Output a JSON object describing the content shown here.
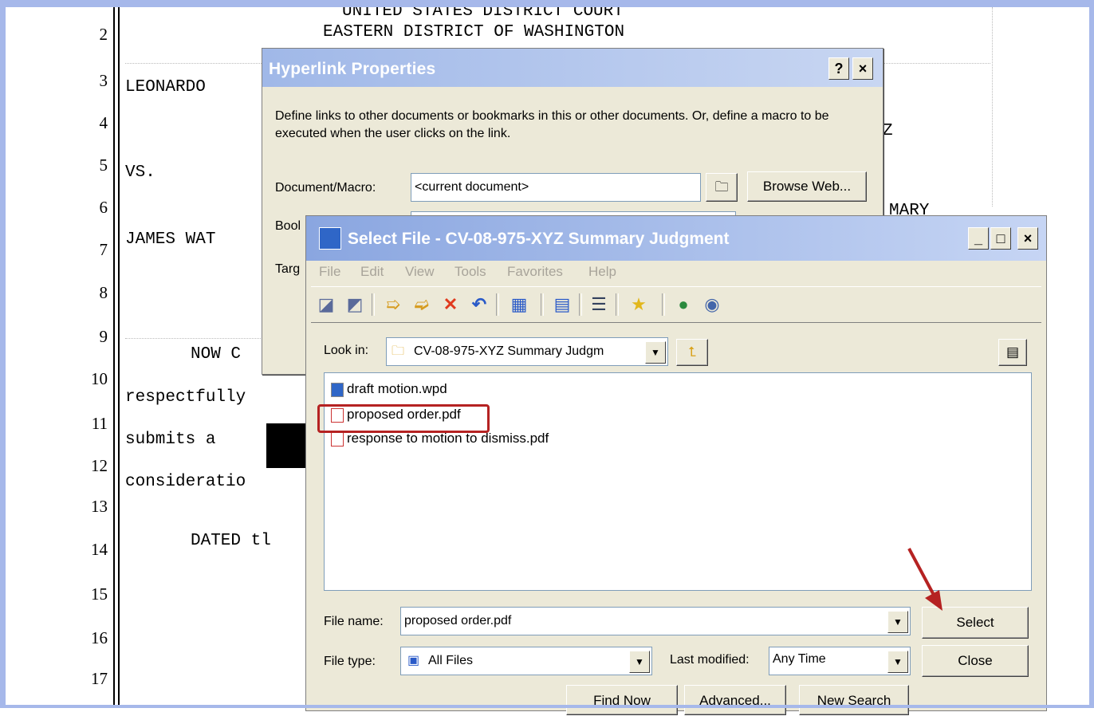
{
  "document": {
    "line_numbers": [
      "2",
      "3",
      "4",
      "5",
      "6",
      "7",
      "8",
      "9",
      "10",
      "11",
      "12",
      "13",
      "14",
      "15",
      "16",
      "17"
    ],
    "court_line1": "UNITED STATES DISTRICT COURT",
    "court_line2": "EASTERN DISTRICT OF WASHINGTON",
    "plaintiff": "LEONARDO",
    "vs": "VS.",
    "defendant": "JAMES WAT",
    "para1": "NOW C",
    "line_respectfully": "respectfully",
    "line_submits": "submits a",
    "line_consideration": "consideratio",
    "dated": "DATED tl",
    "right_fragment_1": "Z",
    "right_fragment_2": "MARY"
  },
  "hyperlink_dialog": {
    "title": "Hyperlink Properties",
    "help_button": "?",
    "close_button": "×",
    "description": "Define links to other documents or bookmarks in this or other documents. Or, define a macro to be executed when the user clicks on the link.",
    "document_macro_label": "Document/Macro:",
    "document_macro_value": "<current document>",
    "browse_web_label": "Browse Web...",
    "bookmark_label_partial": "Bool",
    "target_label_partial": "Targ"
  },
  "select_file_dialog": {
    "title": "Select File - CV-08-975-XYZ Summary Judgment",
    "menu": [
      "File",
      "Edit",
      "View",
      "Tools",
      "Favorites",
      "Help"
    ],
    "look_in_label": "Look in:",
    "look_in_value": "CV-08-975-XYZ Summary Judgm",
    "files": [
      {
        "name": "draft motion.wpd",
        "icon": "wpd-file-icon"
      },
      {
        "name": "proposed order.pdf",
        "icon": "pdf-file-icon"
      },
      {
        "name": "response to motion to dismiss.pdf",
        "icon": "pdf-file-icon"
      }
    ],
    "file_name_label": "File name:",
    "file_name_value": "proposed order.pdf",
    "file_type_label": "File type:",
    "file_type_value": "All Files",
    "last_modified_label": "Last modified:",
    "last_modified_value": "Any Time",
    "select_button": "Select",
    "close_button": "Close",
    "find_now_button": "Find Now",
    "advanced_button": "Advanced...",
    "new_search_button": "New Search",
    "minimize_button": "_",
    "maximize_button": "□",
    "window_close_button": "×"
  },
  "colors": {
    "frame": "#a6b8ea",
    "highlight_box": "#b52222",
    "arrow": "#b52222"
  }
}
